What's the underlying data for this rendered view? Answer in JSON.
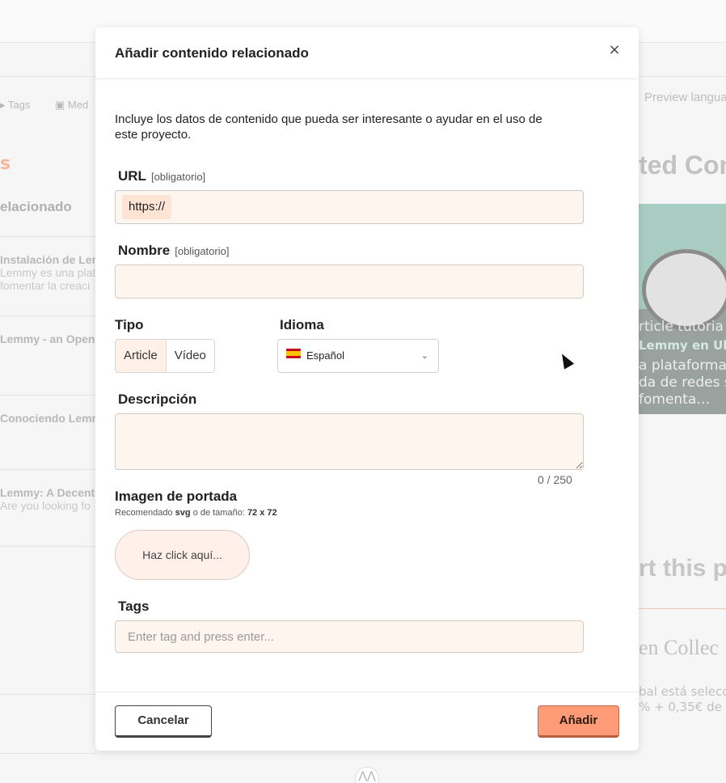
{
  "background": {
    "nav": {
      "tags": "Tags",
      "media": "Med"
    },
    "section_orange": "s",
    "section_heading": "elacionado",
    "items": [
      {
        "title": "Instalación de Lem",
        "desc": "Lemmy es una plat",
        "desc2": "fomentar la creaci"
      },
      {
        "title": "Lemmy - an Open",
        "desc": "",
        "desc2": ""
      },
      {
        "title": "Conociendo Lemm",
        "desc": "",
        "desc2": ""
      },
      {
        "title": "Lemmy: A Decent",
        "desc": "Are you looking fo",
        "desc2": ""
      }
    ],
    "right": {
      "preview": "Preview langua",
      "related_title": "ted Con",
      "card_tags": "rticle tutoria",
      "card_title": "Lemmy en Ubu",
      "card_desc_1": "a plataforma",
      "card_desc_2": "da de redes s",
      "card_desc_3": "fomenta…",
      "support_title": "rt this p",
      "collective": "en Collec",
      "selection_1": "bal está selecci",
      "selection_2": "% + 0,35€ de t"
    },
    "logo": "⋀⋀"
  },
  "modal": {
    "title": "Añadir contenido relacionado",
    "close": "×",
    "intro": "Incluye los datos de contenido que pueda ser interesante o ayudar en el uso de este proyecto.",
    "url": {
      "label": "URL",
      "required": "[obligatorio]",
      "prefix": "https://",
      "value": ""
    },
    "name": {
      "label": "Nombre",
      "required": "[obligatorio]",
      "value": ""
    },
    "type": {
      "label": "Tipo",
      "options": [
        "Article",
        "Vídeo"
      ],
      "selected": "Article"
    },
    "language": {
      "label": "Idioma",
      "selected": "Español"
    },
    "description": {
      "label": "Descripción",
      "counter": "0 / 250"
    },
    "cover": {
      "label": "Imagen de portada",
      "hint_prefix": "Recomendado",
      "hint_format": "svg",
      "hint_mid": "o de tamaño:",
      "hint_size": "72 x 72",
      "button": "Haz click aquí..."
    },
    "tags": {
      "label": "Tags",
      "placeholder": "Enter tag and press enter..."
    },
    "footer": {
      "cancel": "Cancelar",
      "add": "Añadir"
    }
  },
  "colors": {
    "accent": "#ff9b76",
    "input_bg": "#fff5ef"
  }
}
